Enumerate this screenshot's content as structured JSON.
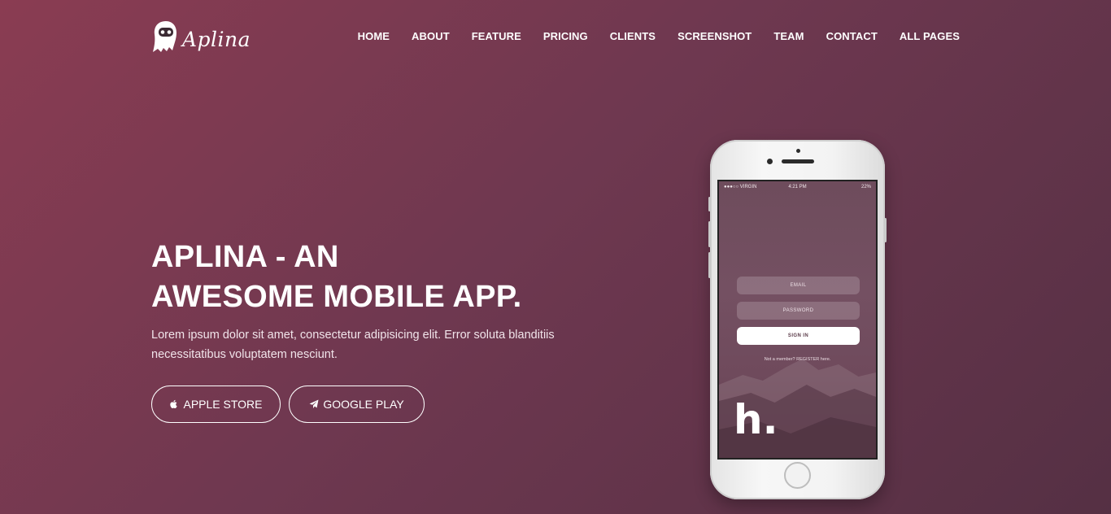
{
  "brand": {
    "name": "Aplina",
    "logo_icon": "robot-ghost-icon"
  },
  "nav": {
    "items": [
      "HOME",
      "ABOUT",
      "FEATURE",
      "PRICING",
      "CLIENTS",
      "SCREENSHOT",
      "TEAM",
      "CONTACT",
      "ALL PAGES"
    ]
  },
  "hero": {
    "title_line1": "APLINA - AN",
    "title_line2": "AWESOME MOBILE APP.",
    "description": "Lorem ipsum dolor sit amet, consectetur adipisicing elit. Error soluta blanditiis necessitatibus voluptatem nesciunt.",
    "buttons": {
      "apple": {
        "label": "APPLE STORE",
        "icon": "apple-icon"
      },
      "google": {
        "label": "GOOGLE PLAY",
        "icon": "paper-plane-icon"
      }
    }
  },
  "phone": {
    "status": {
      "carrier": "●●●○○ VIRGIN",
      "time": "4:21 PM",
      "battery": "22%"
    },
    "email_placeholder": "EMAIL",
    "password_placeholder": "PASSWORD",
    "signin_label": "SIGN IN",
    "register_text": "Not a member? REGISTER here.",
    "app_logo": "h."
  },
  "colors": {
    "bg_start": "#8a3c52",
    "bg_end": "#553044",
    "text": "#ffffff"
  }
}
